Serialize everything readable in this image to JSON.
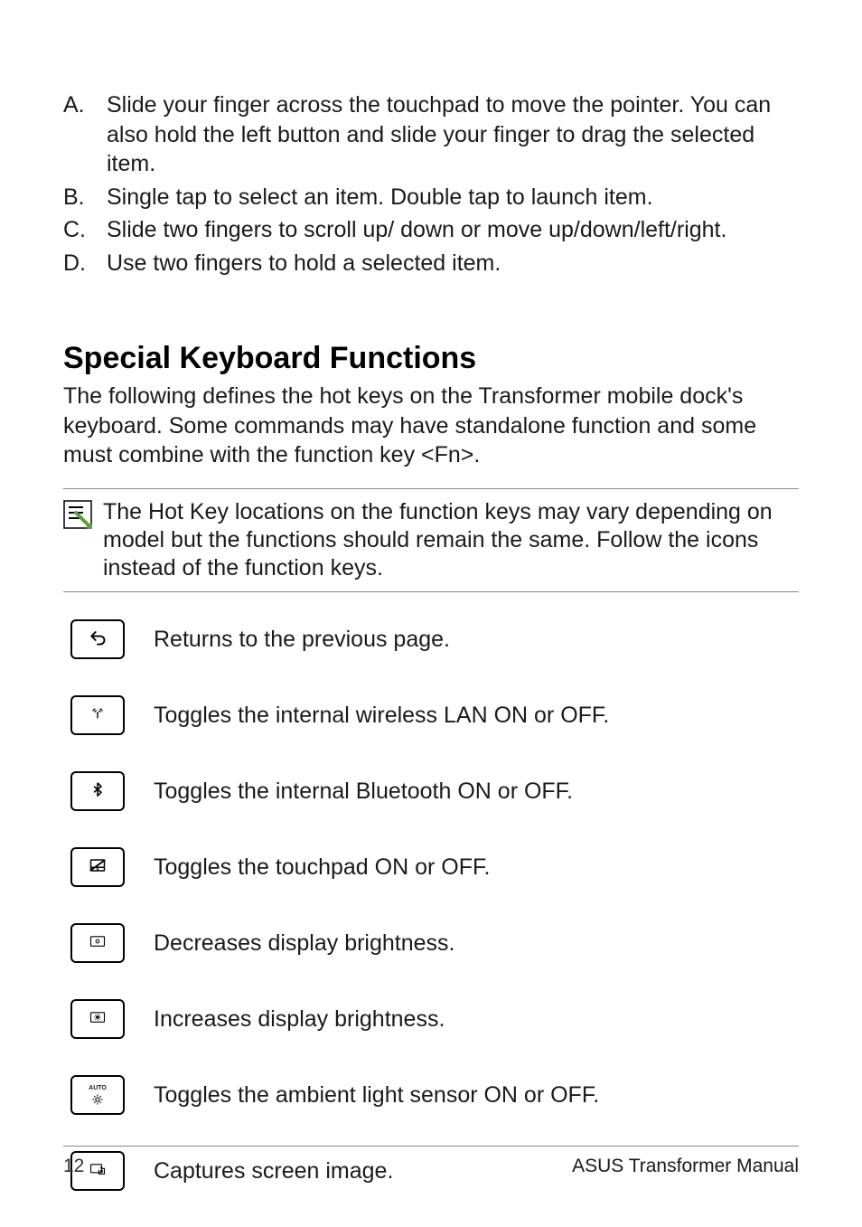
{
  "list": [
    {
      "letter": "A.",
      "text": "Slide your finger across the touchpad to move the pointer. You can also hold the left button and slide your finger to drag the selected item."
    },
    {
      "letter": "B.",
      "text": "Single tap to select an item. Double tap to launch item."
    },
    {
      "letter": "C.",
      "text": "Slide two fingers to scroll up/ down or move up/down/left/right."
    },
    {
      "letter": "D.",
      "text": "Use two fingers to hold a selected item."
    }
  ],
  "heading": "Special Keyboard Functions",
  "intro": "The following defines the hot keys on the Transformer mobile dock's keyboard. Some commands may have standalone function and some must combine with the function key <Fn>.",
  "note": "The Hot Key locations on the function keys may vary depending on model but the functions should remain the same. Follow the icons instead of the function keys.",
  "keys": [
    {
      "icon": "back-icon",
      "desc": "Returns to the previous page."
    },
    {
      "icon": "wifi-icon",
      "desc": "Toggles the internal wireless LAN ON or OFF."
    },
    {
      "icon": "bluetooth-icon",
      "desc": "Toggles the internal Bluetooth ON or OFF."
    },
    {
      "icon": "touchpad-off-icon",
      "desc": "Toggles the touchpad ON or OFF."
    },
    {
      "icon": "brightness-down-icon",
      "desc": "Decreases display brightness."
    },
    {
      "icon": "brightness-up-icon",
      "desc": "Increases display brightness."
    },
    {
      "icon": "auto-light-icon",
      "desc": "Toggles the ambient light sensor ON or OFF."
    },
    {
      "icon": "screenshot-icon",
      "desc": "Captures screen image."
    }
  ],
  "auto_label": "AUTO",
  "footer": {
    "page": "12",
    "title": "ASUS Transformer Manual"
  }
}
